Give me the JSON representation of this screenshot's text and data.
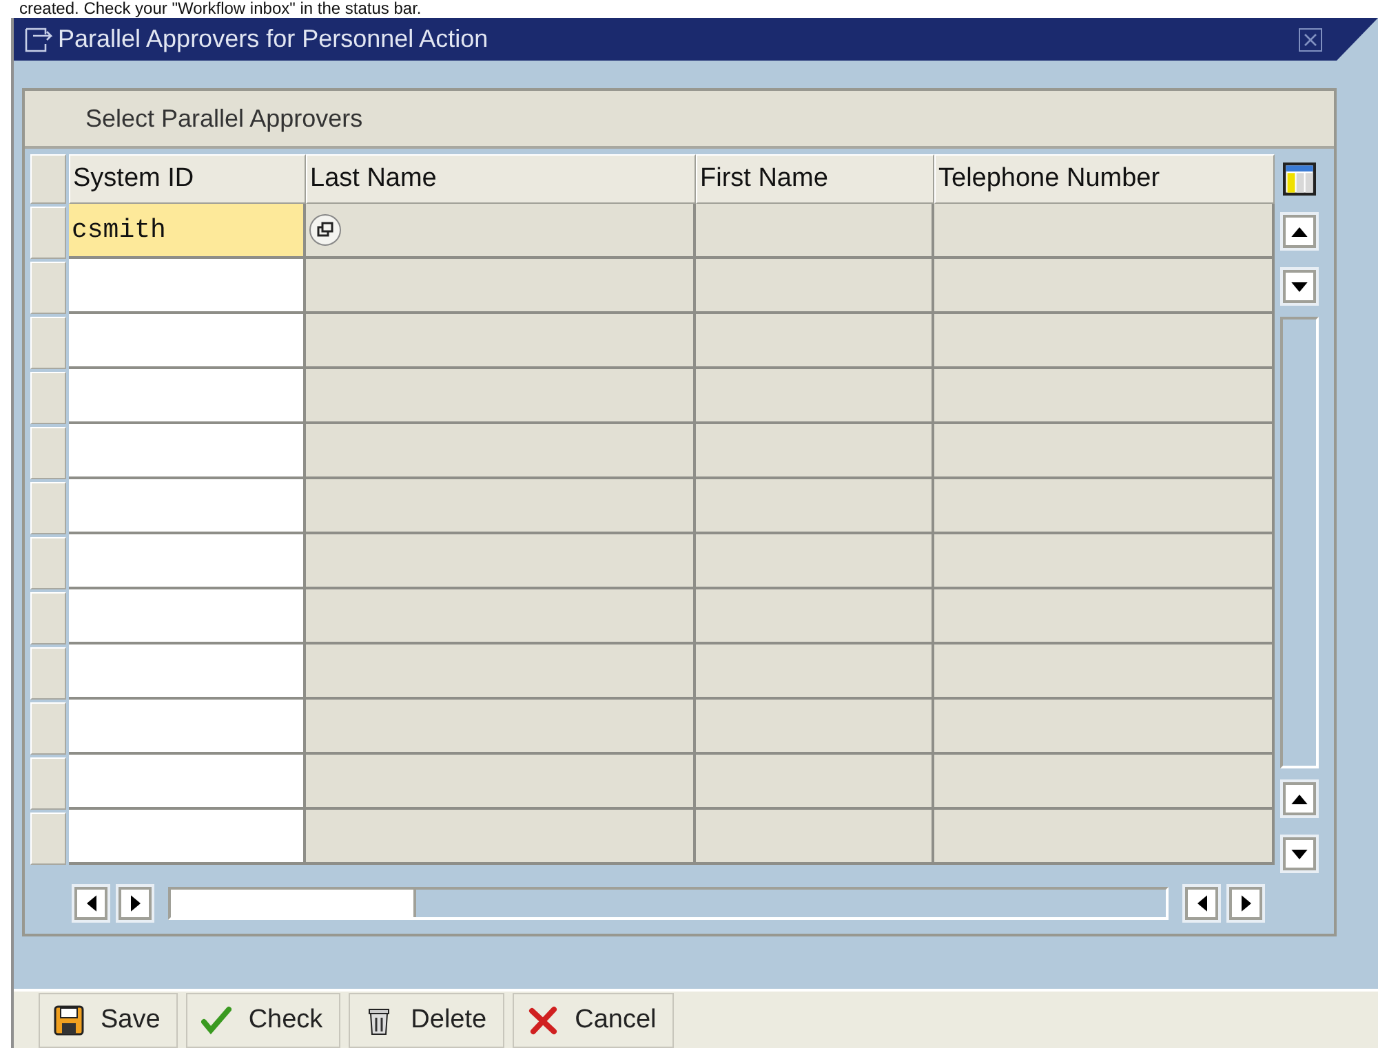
{
  "status_line": "created. Check your \"Workflow inbox\" in the status bar.",
  "window": {
    "title": "Parallel Approvers for Personnel Action"
  },
  "panel": {
    "title": "Select Parallel Approvers"
  },
  "table": {
    "columns": [
      "System ID",
      "Last Name",
      "First Name",
      "Telephone Number"
    ],
    "rows": [
      {
        "system_id": "csmith",
        "focused": true
      },
      {
        "focused": false
      },
      {
        "focused": false
      },
      {
        "focused": false
      },
      {
        "focused": false
      },
      {
        "focused": false
      },
      {
        "focused": false
      },
      {
        "focused": false
      },
      {
        "focused": false
      },
      {
        "focused": false
      },
      {
        "focused": false
      },
      {
        "focused": false
      }
    ]
  },
  "buttons": [
    {
      "kind": "save",
      "label": "Save"
    },
    {
      "kind": "check",
      "label": "Check"
    },
    {
      "kind": "delete",
      "label": "Delete"
    },
    {
      "kind": "cancel",
      "label": "Cancel"
    }
  ]
}
